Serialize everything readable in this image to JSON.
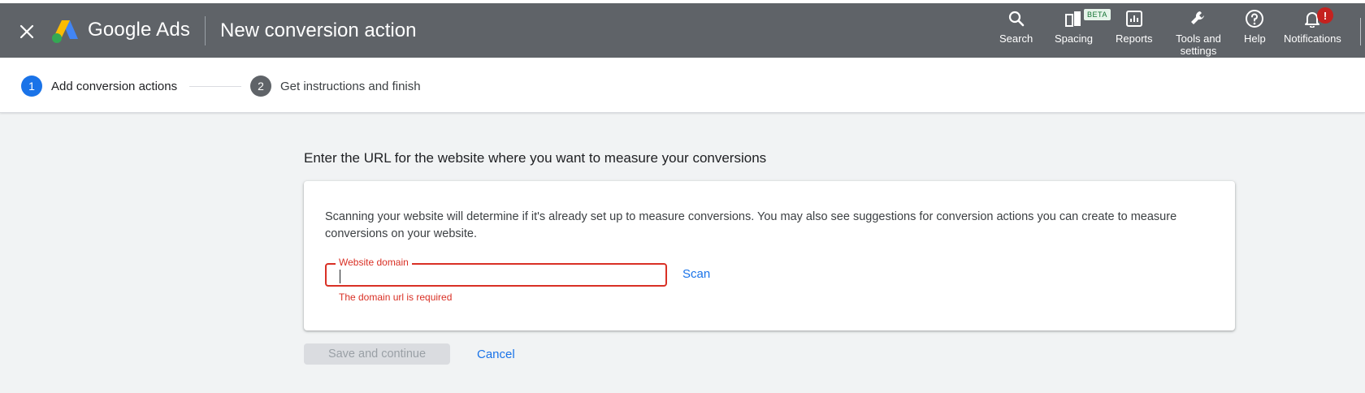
{
  "header": {
    "brand": "Google Ads",
    "page_title": "New conversion action",
    "nav": [
      {
        "label": "Search",
        "icon": "search-icon"
      },
      {
        "label": "Spacing",
        "icon": "spacing-icon",
        "badge": "BETA"
      },
      {
        "label": "Reports",
        "icon": "reports-icon"
      },
      {
        "label": "Tools and settings",
        "icon": "wrench-icon"
      },
      {
        "label": "Help",
        "icon": "help-icon"
      },
      {
        "label": "Notifications",
        "icon": "bell-icon",
        "badge": "!"
      }
    ]
  },
  "stepper": {
    "steps": [
      {
        "number": "1",
        "label": "Add conversion actions",
        "state": "active"
      },
      {
        "number": "2",
        "label": "Get instructions and finish",
        "state": "inactive"
      }
    ]
  },
  "main": {
    "section_title": "Enter the URL for the website where you want to measure your conversions",
    "description": "Scanning your website will determine if it's already set up to measure conversions. You may also see suggestions for conversion actions you can create to measure conversions on your website.",
    "field": {
      "label": "Website domain",
      "value": "",
      "error": "The domain url is required"
    },
    "scan_label": "Scan",
    "save_label": "Save and continue",
    "cancel_label": "Cancel"
  },
  "colors": {
    "header_bg": "#5f6368",
    "accent": "#1a73e8",
    "error": "#d93025",
    "page_bg": "#f1f3f4"
  }
}
